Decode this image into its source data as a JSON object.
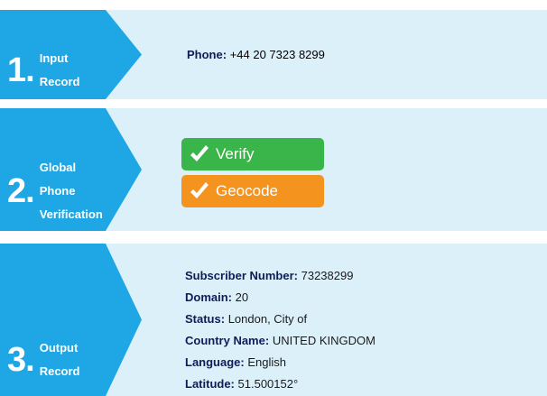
{
  "colors": {
    "band_bg": "#dcf0f9",
    "arrow": "#1ea7e4",
    "verify": "#3ab54a",
    "geocode": "#f5931f",
    "label_dark": "#0c1d58"
  },
  "steps": [
    {
      "number": "1",
      "dot": ".",
      "label_line1": "Input",
      "label_line2": "Record",
      "label_line3": ""
    },
    {
      "number": "2",
      "dot": ".",
      "label_line1": "Global",
      "label_line2": "Phone",
      "label_line3": "Verification"
    },
    {
      "number": "3",
      "dot": ".",
      "label_line1": "Output",
      "label_line2": "Record",
      "label_line3": ""
    }
  ],
  "input_record": {
    "phone_label": "Phone:",
    "phone_value": "+44 20 7323 8299"
  },
  "verification": {
    "verify_label": "Verify",
    "geocode_label": "Geocode",
    "check_icon": "checkmark-icon"
  },
  "output_record": [
    {
      "key": "Subscriber Number:",
      "value": "73238299"
    },
    {
      "key": "Domain:",
      "value": "20"
    },
    {
      "key": "Status:",
      "value": "London, City of"
    },
    {
      "key": "Country Name:",
      "value": "UNITED KINGDOM"
    },
    {
      "key": "Language:",
      "value": "English"
    },
    {
      "key": "Latitude:",
      "value": "51.500152°"
    }
  ]
}
